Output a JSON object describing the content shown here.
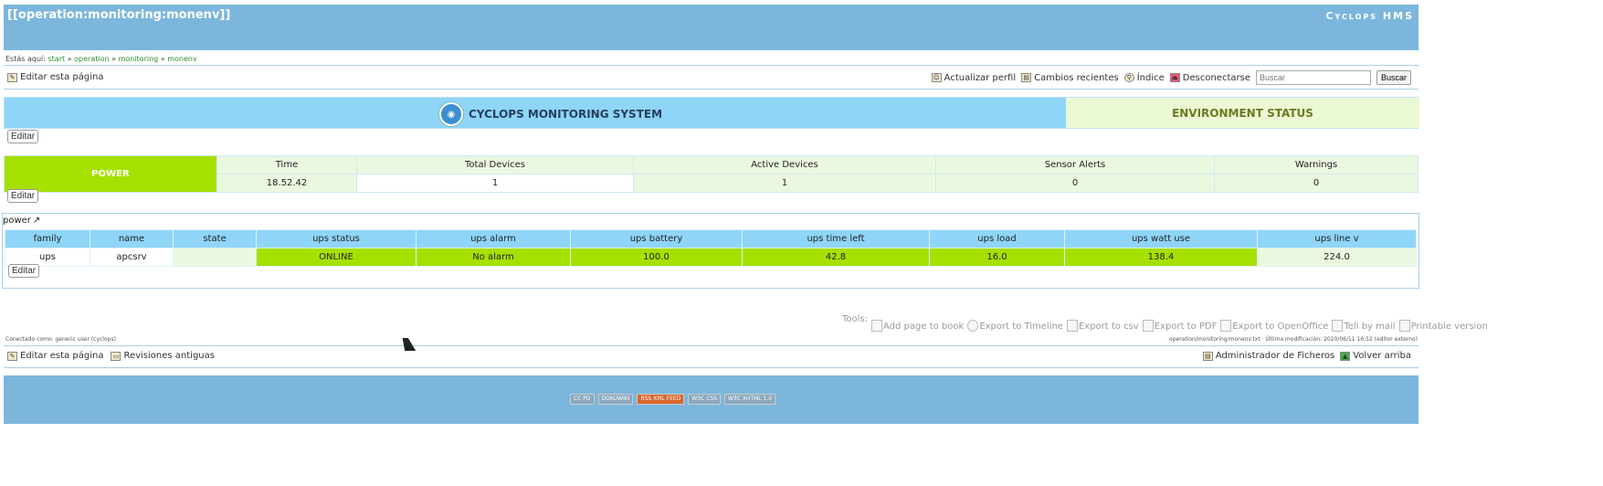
{
  "header": {
    "page_title": "[[operation:monitoring:monenv]]",
    "site_title": "Cyclops HMS"
  },
  "breadcrumb": {
    "label": "Estás aquí:",
    "items": [
      "start",
      "operation",
      "monitoring",
      "monenv"
    ],
    "sep": "»"
  },
  "toolbar": {
    "edit_page": "Editar esta página",
    "update_profile": "Actualizar perfil",
    "recent_changes": "Cambios recientes",
    "index": "Índice",
    "logout": "Desconectarse",
    "search_placeholder": "Buscar",
    "search_button": "Buscar"
  },
  "banner": {
    "title": "CYCLOPS MONITORING SYSTEM",
    "status": "ENVIRONMENT STATUS"
  },
  "edit_label": "Editar",
  "power": {
    "label": "POWER",
    "headers": [
      "Time",
      "Total Devices",
      "Active Devices",
      "Sensor Alerts",
      "Warnings"
    ],
    "values": [
      "18.52.42",
      "1",
      "1",
      "0",
      "0"
    ]
  },
  "ups": {
    "section_label": "power",
    "headers": [
      "family",
      "name",
      "state",
      "ups status",
      "ups alarm",
      "ups battery",
      "ups time left",
      "ups load",
      "ups watt use",
      "ups line v"
    ],
    "row": [
      "ups",
      "apcsrv",
      "",
      "ONLINE",
      "No alarm",
      "100.0",
      "42.8",
      "16.0",
      "138.4",
      "224.0"
    ]
  },
  "tools": {
    "label": "Tools:",
    "items": [
      "Add page to book",
      "Export to Timeline",
      "Export to csv",
      "Export to PDF",
      "Export to OpenOffice",
      "Tell by mail",
      "Printable version"
    ]
  },
  "meta": {
    "left": "Conectado como: generic user (cyclops)",
    "right": "operation/monitoring/monenv.txt · Última modificación: 2020/06/11 16:52 (editor externo)"
  },
  "bottom": {
    "edit_page": "Editar esta página",
    "old_revisions": "Revisiones antiguas",
    "file_manager": "Administrador de Ficheros",
    "back_top": "Volver arriba"
  },
  "footer_badges": [
    "CC PD",
    "DOKUWIKI",
    "RSS XML FEED",
    "W3C CSS",
    "W3C XHTML 1.0"
  ],
  "colors": {
    "header": "#7cb6dc",
    "banner": "#8fd5f8",
    "power_green": "#a6e000",
    "status_bg": "#eaf9d4"
  }
}
